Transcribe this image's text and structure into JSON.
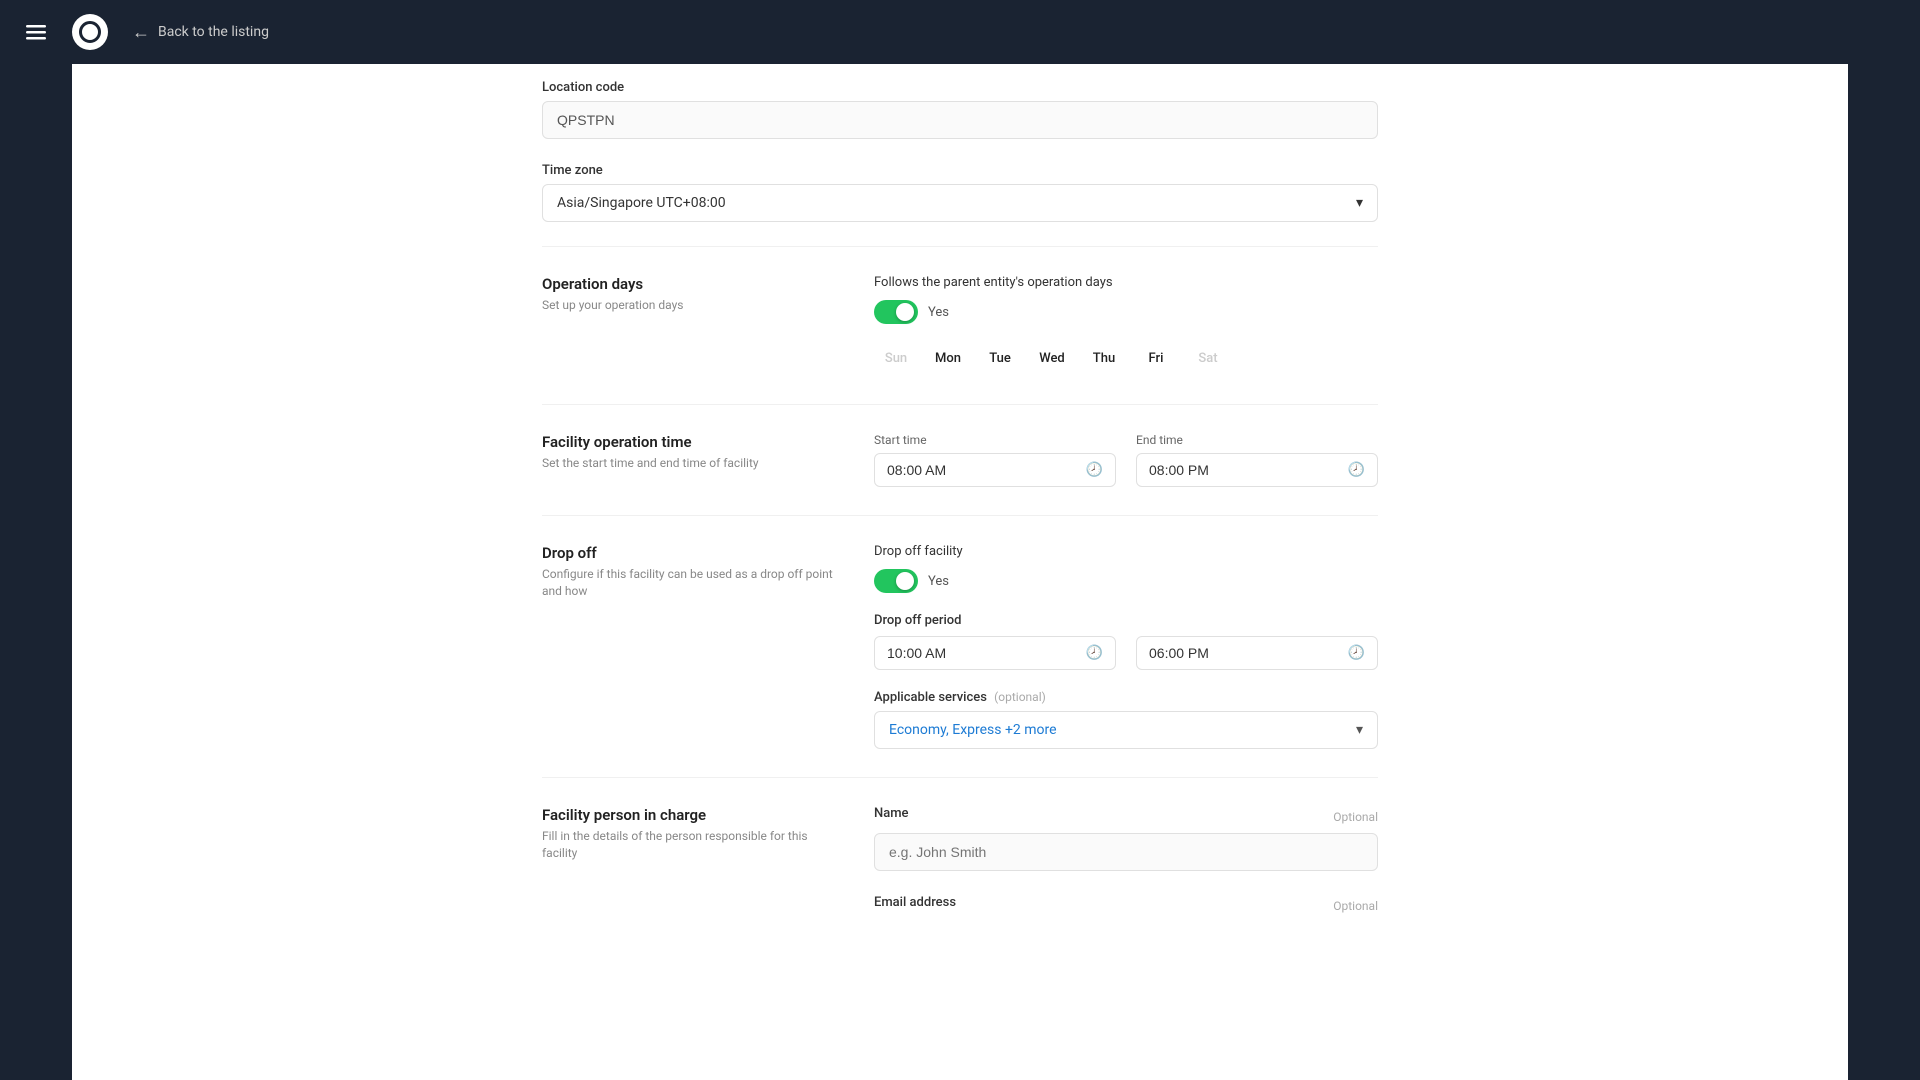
{
  "topbar": {
    "back_label": "Back to the listing"
  },
  "location_code": {
    "label": "Location code",
    "value": "QPSTPN"
  },
  "time_zone": {
    "label": "Time zone",
    "value": "Asia/Singapore UTC+08:00"
  },
  "operation_days": {
    "section_title": "Operation days",
    "section_desc": "Set up your operation days",
    "follows_label": "Follows the parent entity's operation days",
    "toggle_value": "Yes",
    "days": [
      "Sun",
      "Mon",
      "Tue",
      "Wed",
      "Thu",
      "Fri",
      "Sat"
    ],
    "active_days": [
      "Mon",
      "Tue",
      "Wed",
      "Thu",
      "Fri"
    ]
  },
  "facility_operation_time": {
    "section_title": "Facility operation time",
    "section_desc": "Set the start time and end time of facility",
    "start_time_label": "Start time",
    "start_time_value": "08:00 AM",
    "end_time_label": "End time",
    "end_time_value": "08:00 PM"
  },
  "drop_off": {
    "section_title": "Drop off",
    "section_desc": "Configure if this facility can be used as a drop off point and how",
    "facility_label": "Drop off facility",
    "toggle_value": "Yes",
    "period_label": "Drop off period",
    "start_time": "10:00 AM",
    "end_time": "06:00 PM",
    "applicable_label": "Applicable services",
    "optional_tag": "(optional)",
    "services_value": "Economy, Express +2 more"
  },
  "facility_person": {
    "section_title": "Facility person in charge",
    "section_desc": "Fill in the details of the person responsible for this facility",
    "name_label": "Name",
    "name_optional": "Optional",
    "name_placeholder": "e.g. John Smith",
    "email_label": "Email address",
    "email_optional": "Optional"
  }
}
